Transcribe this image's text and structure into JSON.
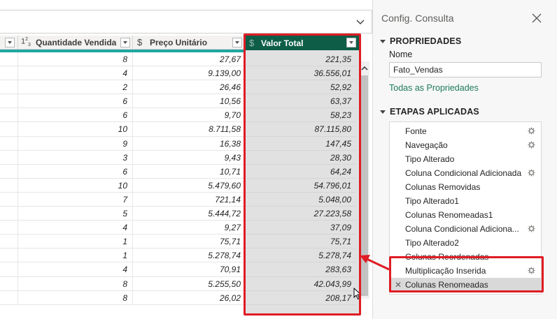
{
  "grid": {
    "columns": [
      {
        "type_icon": "text-type-icon",
        "label": ""
      },
      {
        "type_icon": "123",
        "label": "Quantidade Vendida"
      },
      {
        "type_icon": "$",
        "label": "Preço Unitário"
      },
      {
        "type_icon": "$",
        "label": "Valor Total"
      }
    ],
    "rows": [
      {
        "qtd": "8",
        "preco": "27,67",
        "total": "221,35"
      },
      {
        "qtd": "4",
        "preco": "9.139,00",
        "total": "36.556,01"
      },
      {
        "qtd": "2",
        "preco": "26,46",
        "total": "52,92"
      },
      {
        "qtd": "6",
        "preco": "10,56",
        "total": "63,37"
      },
      {
        "qtd": "6",
        "preco": "9,70",
        "total": "58,23"
      },
      {
        "qtd": "10",
        "preco": "8.711,58",
        "total": "87.115,80"
      },
      {
        "qtd": "9",
        "preco": "16,38",
        "total": "147,45"
      },
      {
        "qtd": "3",
        "preco": "9,43",
        "total": "28,30"
      },
      {
        "qtd": "6",
        "preco": "10,71",
        "total": "64,24"
      },
      {
        "qtd": "10",
        "preco": "5.479,60",
        "total": "54.796,01"
      },
      {
        "qtd": "7",
        "preco": "721,14",
        "total": "5.048,00"
      },
      {
        "qtd": "5",
        "preco": "5.444,72",
        "total": "27.223,58"
      },
      {
        "qtd": "4",
        "preco": "9,27",
        "total": "37,09"
      },
      {
        "qtd": "1",
        "preco": "75,71",
        "total": "75,71"
      },
      {
        "qtd": "1",
        "preco": "5.278,74",
        "total": "5.278,74"
      },
      {
        "qtd": "4",
        "preco": "70,91",
        "total": "283,63"
      },
      {
        "qtd": "8",
        "preco": "5.255,50",
        "total": "42.043,99"
      },
      {
        "qtd": "8",
        "preco": "26,02",
        "total": "208,17"
      }
    ],
    "colors": {
      "highlight_header": "#0e5e47",
      "teal_line": "#1fa7a0",
      "annotation_red": "#e01b24"
    }
  },
  "pane": {
    "title": "Config. Consulta",
    "close_icon": "close-icon",
    "properties_header": "PROPRIEDADES",
    "name_label": "Nome",
    "name_value": "Fato_Vendas",
    "all_properties_link": "Todas as Propriedades",
    "steps_header": "ETAPAS APLICADAS",
    "steps": [
      {
        "label": "Fonte",
        "gear": true
      },
      {
        "label": "Navegação",
        "gear": true
      },
      {
        "label": "Tipo Alterado",
        "gear": false
      },
      {
        "label": "Coluna Condicional Adicionada",
        "gear": true
      },
      {
        "label": "Colunas Removidas",
        "gear": false
      },
      {
        "label": "Tipo Alterado1",
        "gear": false
      },
      {
        "label": "Colunas Renomeadas1",
        "gear": false
      },
      {
        "label": "Coluna Condicional Adiciona...",
        "gear": true
      },
      {
        "label": "Tipo Alterado2",
        "gear": false
      },
      {
        "label": "Colunas Reordenadas",
        "gear": false
      },
      {
        "label": "Multiplicação Inserida",
        "gear": true
      },
      {
        "label": "Colunas Renomeadas",
        "gear": false,
        "selected": true
      }
    ]
  }
}
